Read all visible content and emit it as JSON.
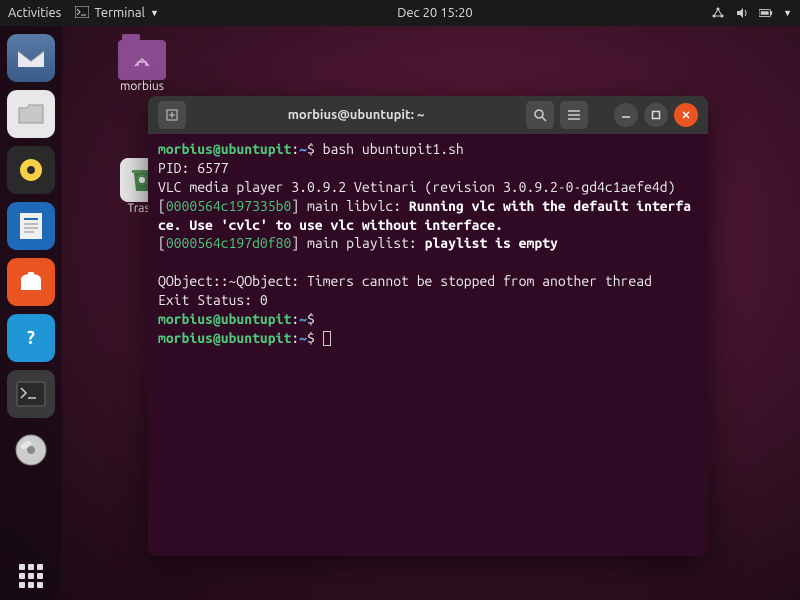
{
  "topbar": {
    "activities": "Activities",
    "app_name": "Terminal",
    "datetime": "Dec 20  15:20"
  },
  "desktop": {
    "folder_label": "morbius",
    "trash_label": "Trash"
  },
  "terminal": {
    "title": "morbius@ubuntupit: ~",
    "prompt_user_host": "morbius@ubuntupit",
    "prompt_sep": ":",
    "prompt_path": "~",
    "prompt_end": "$ ",
    "cmd1": "bash ubuntupit1.sh",
    "out_pid": "PID: 6577",
    "out_vlc_ver": "VLC media player 3.0.9.2 Vetinari (revision 3.0.9.2-0-gd4c1aefe4d)",
    "addr1": "0000564c197335b0",
    "libvlc_prefix": " main libvlc: ",
    "libvlc_bold": "Running vlc with the default interface. Use 'cvlc' to use vlc without interface.",
    "addr2": "0000564c197d0f80",
    "playlist_prefix": " main playlist: ",
    "playlist_bold": "playlist is empty",
    "out_qobject": "QObject::~QObject: Timers cannot be stopped from another thread",
    "out_exit": "Exit Status: 0"
  }
}
